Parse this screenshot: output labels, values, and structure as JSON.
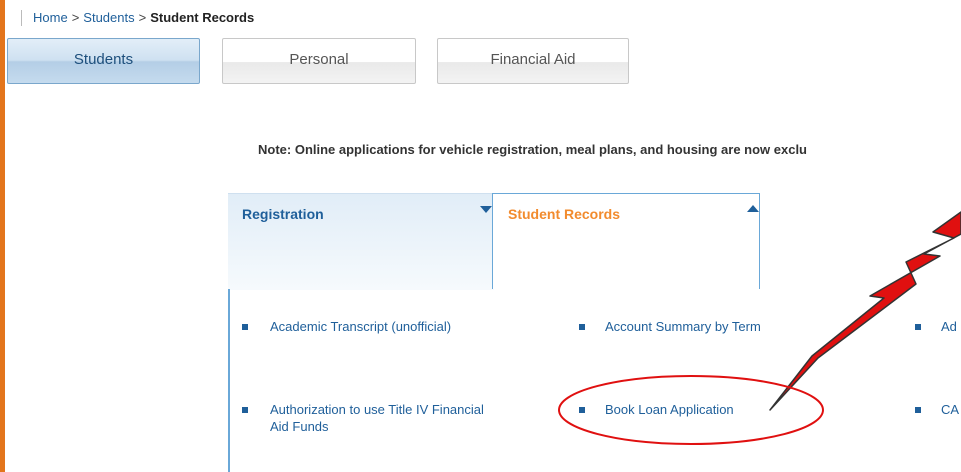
{
  "breadcrumb": {
    "home": "Home",
    "sep1": ">",
    "students": "Students",
    "sep2": ">",
    "current": "Student Records"
  },
  "tabs": [
    {
      "label": "Students",
      "active": true
    },
    {
      "label": "Personal",
      "active": false
    },
    {
      "label": "Financial Aid",
      "active": false
    }
  ],
  "note": "Note: Online applications for vehicle registration, meal plans, and housing are now exclu",
  "panels": {
    "registration": "Registration",
    "student_records": "Student Records"
  },
  "links": {
    "academic_transcript": "Academic Transcript (unofficial)",
    "account_summary": "Account Summary by Term",
    "col3_row1": "Ad",
    "authorization_line1": "Authorization to use Title IV Financial",
    "authorization_line2": "Aid Funds",
    "book_loan": "Book Loan Application",
    "col3_row2": "CA"
  },
  "colors": {
    "link_blue": "#1f5f9a",
    "accent_orange": "#f28b2d",
    "callout_red": "#e01010",
    "left_border": "#e3751c"
  }
}
